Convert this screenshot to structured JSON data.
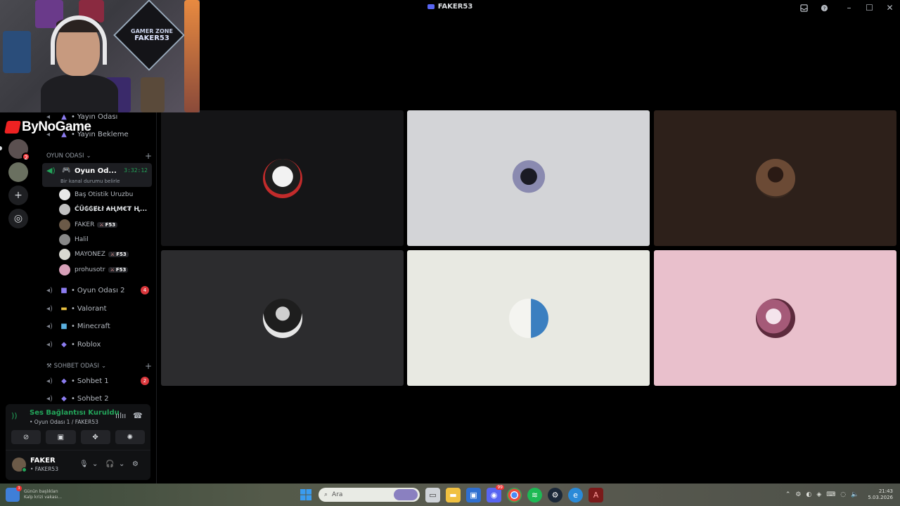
{
  "window": {
    "title": "FAKER53"
  },
  "brand": {
    "text": "ByNoGame"
  },
  "webcam": {
    "sign_text": "FAKER53",
    "gamer_zone": "GAMER ZONE"
  },
  "channels": {
    "top_items": [
      "Yayın Odası",
      "Yayın Bekleme"
    ],
    "category_game": "OYUN ODASI",
    "active": {
      "name": "Oyun Od...",
      "timer": "3:32:12",
      "status": "Bir kanal durumu belirle"
    },
    "members": [
      {
        "name": "Baş Otistik Uruzbu",
        "tag": "",
        "color": "#e8e8e8"
      },
      {
        "name": "ĆÜ₲₲ɆŁł ₳ⱧM€₮ Ⱨ...",
        "tag": "",
        "color": "#c0c0c0"
      },
      {
        "name": "FAKER",
        "tag": "F53",
        "color": "#6b5a48"
      },
      {
        "name": "Halil",
        "tag": "",
        "color": "#888888"
      },
      {
        "name": "MAYONEZ",
        "tag": "F53",
        "color": "#d8d8d0"
      },
      {
        "name": "prohusotr",
        "tag": "F53",
        "color": "#d7a0b8"
      }
    ],
    "others": [
      {
        "name": "Oyun Odası 2",
        "icon": "🎮",
        "badge": "4"
      },
      {
        "name": "Valorant",
        "icon": "▬",
        "badge": ""
      },
      {
        "name": "Minecraft",
        "icon": "■",
        "badge": ""
      },
      {
        "name": "Roblox",
        "icon": "👾",
        "badge": ""
      }
    ],
    "category_chat": "SOHBET ODASI",
    "chat": [
      {
        "name": "Sohbet 1",
        "badge": "2"
      },
      {
        "name": "Sohbet 2",
        "badge": ""
      }
    ],
    "separator": "•"
  },
  "rail": {
    "badge": "2"
  },
  "voice": {
    "title": "Ses Bağlantısı Kuruldu",
    "subtitle": "• Oyun Odası 1 / FAKER53",
    "user_name": "FAKER",
    "user_sub": "• FAKER53"
  },
  "tiles": [
    {
      "bg": "#151517",
      "pic": "#c22b2b"
    },
    {
      "bg": "#d3d4d7",
      "pic": "#5a5a78"
    },
    {
      "bg": "#2d201a",
      "pic": "#6b4a35"
    },
    {
      "bg": "#2c2c2e",
      "pic": "#3a3a3a"
    },
    {
      "bg": "#e8e9e2",
      "pic": "#3b7fc0"
    },
    {
      "bg": "#e9c0cc",
      "pic": "#a55a78"
    }
  ],
  "taskbar": {
    "search_placeholder": "Ara",
    "weather_badge": "3",
    "weather_line1": "Günün başlıkları",
    "weather_line2": "Kalp krizi vakası...",
    "time": "21:43",
    "date": "5.03.2026",
    "discord_badge": "99"
  }
}
